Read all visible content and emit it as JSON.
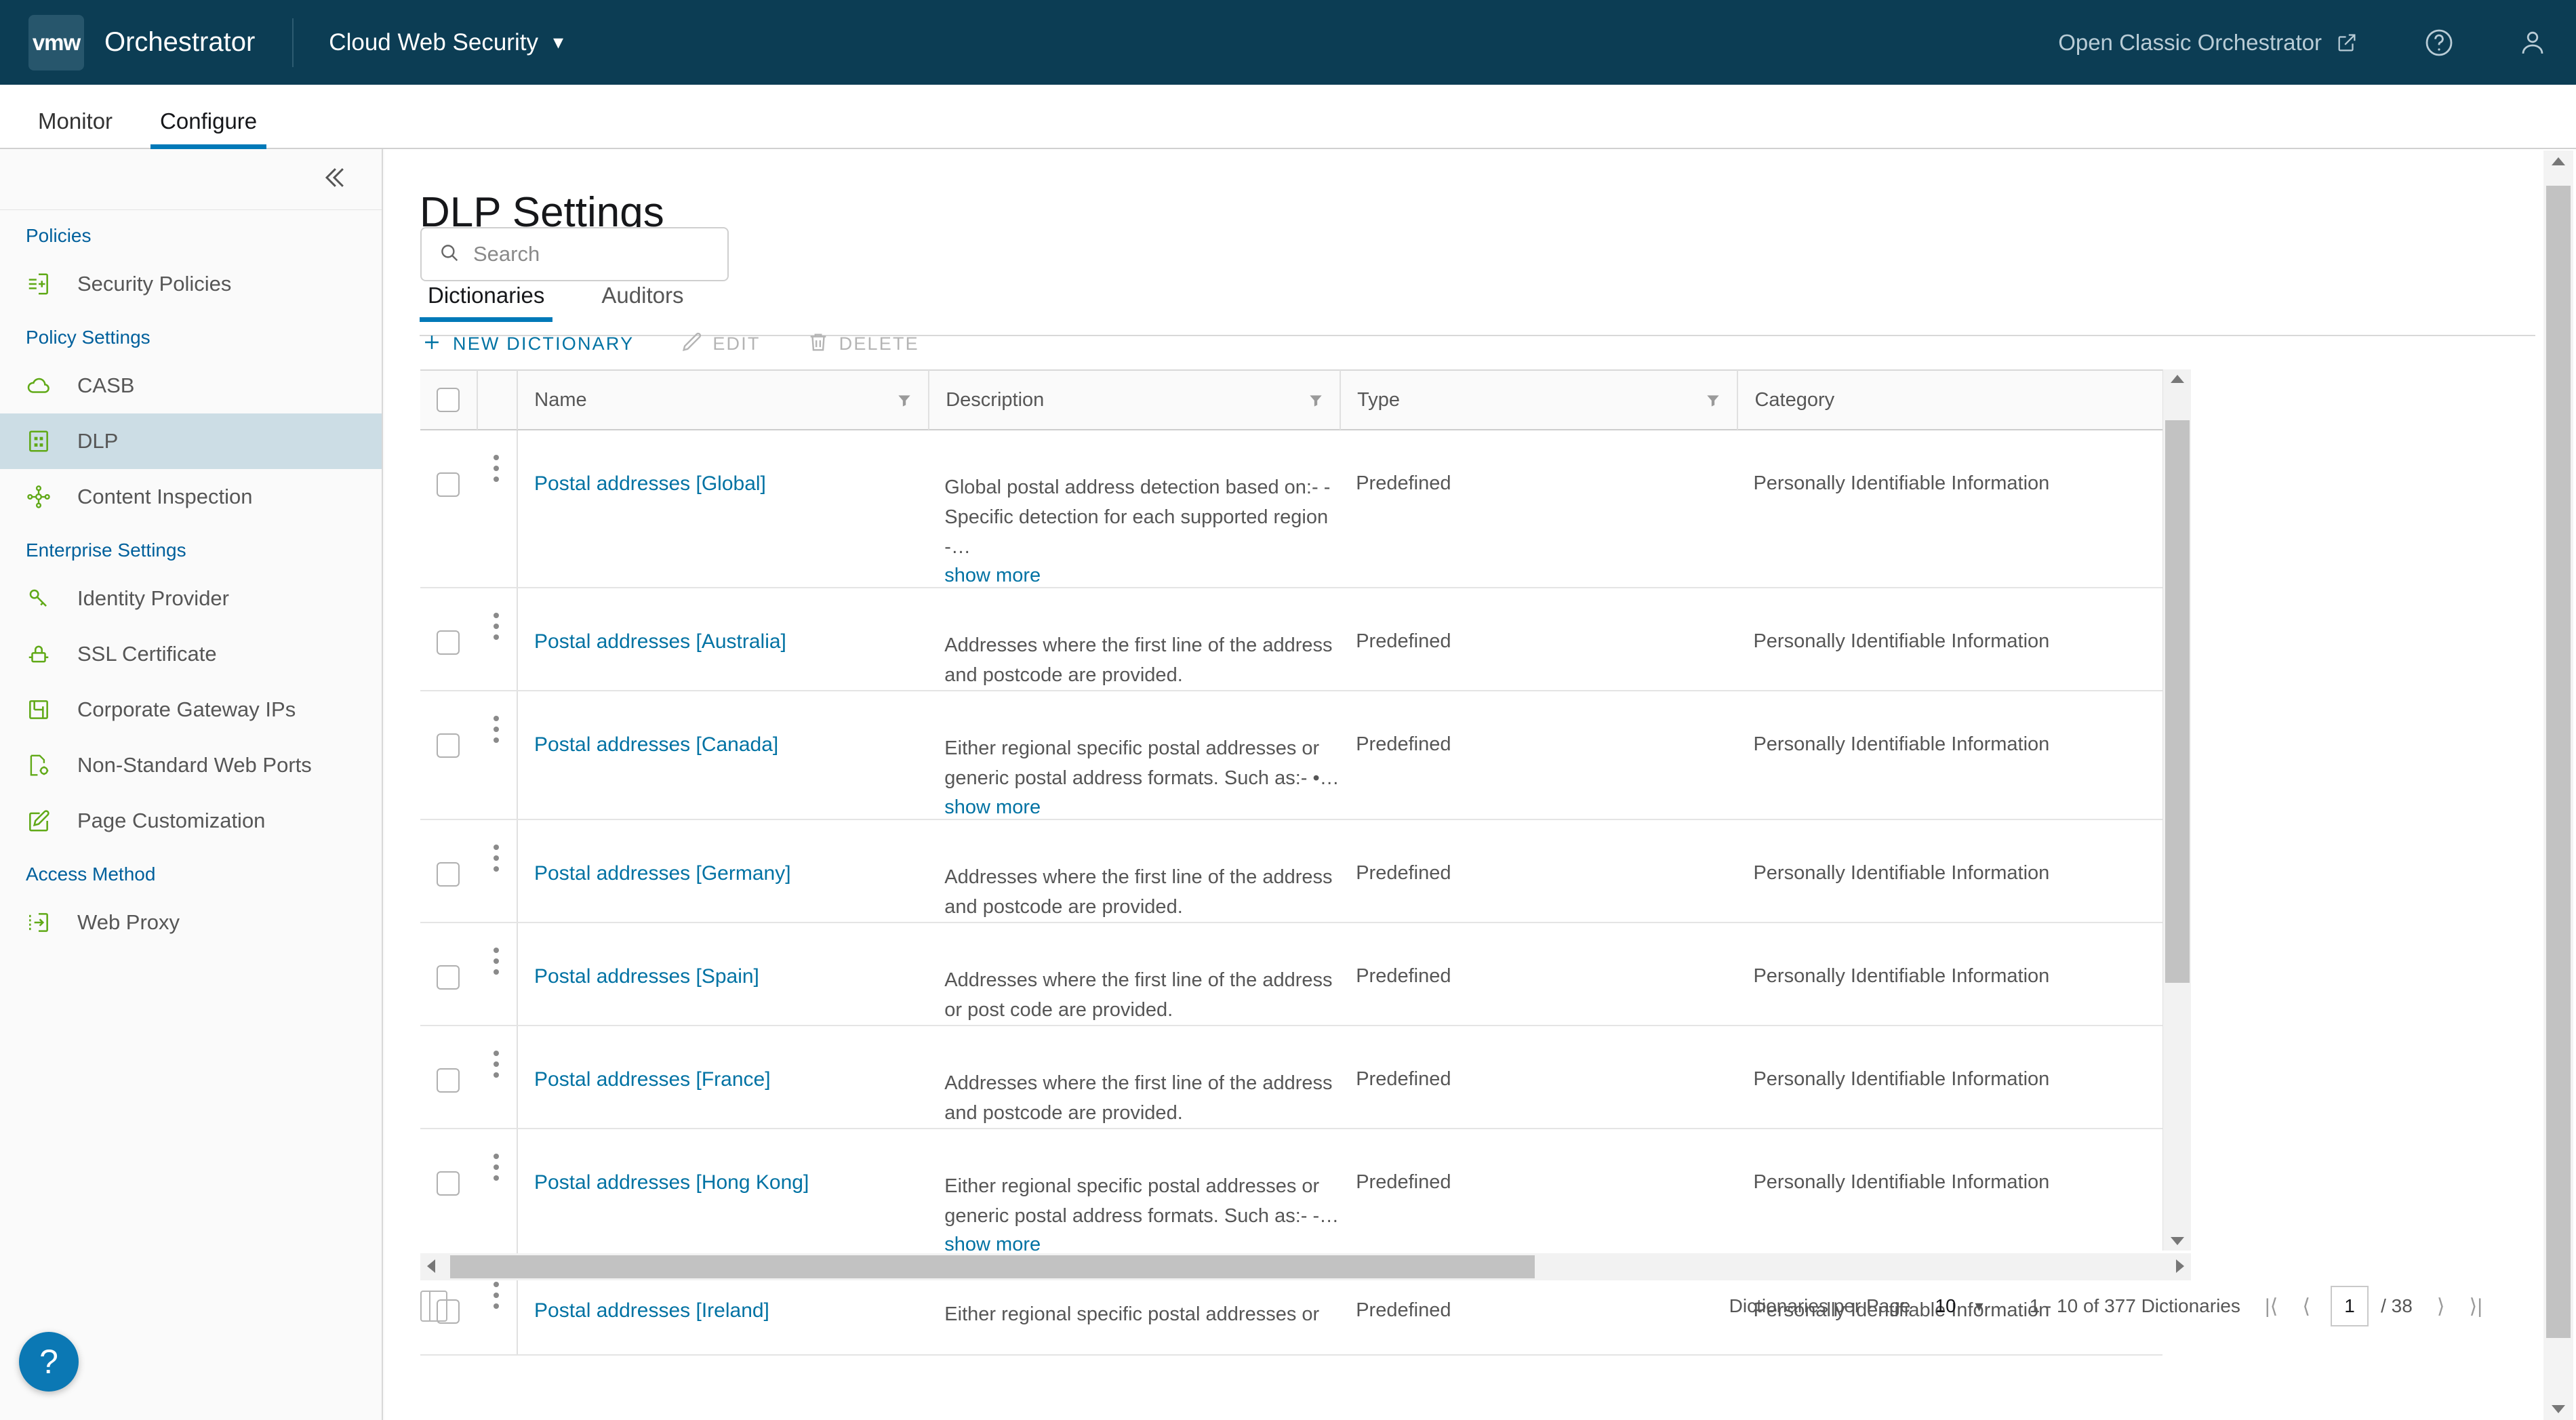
{
  "header": {
    "logo_text": "vmw",
    "app_title": "Orchestrator",
    "service_name": "Cloud Web Security",
    "service_caret": "chevron-down-icon",
    "classic_link": "Open Classic Orchestrator",
    "external_icon": "external-link-icon",
    "help_icon": "help-circle-icon",
    "user_icon": "user-avatar-icon",
    "bg_color": "#0c3d54"
  },
  "nav_tabs": [
    {
      "label": "Monitor",
      "active": false
    },
    {
      "label": "Configure",
      "active": true
    }
  ],
  "sidebar": {
    "collapse_icon": "double-chevron-left-icon",
    "groups": [
      {
        "title": "Policies",
        "items": [
          {
            "label": "Security Policies",
            "icon": "policy-add-icon",
            "selected": false
          }
        ]
      },
      {
        "title": "Policy Settings",
        "items": [
          {
            "label": "CASB",
            "icon": "cloud-icon",
            "selected": false
          },
          {
            "label": "DLP",
            "icon": "grid-table-icon",
            "selected": true
          },
          {
            "label": "Content Inspection",
            "icon": "nodes-icon",
            "selected": false
          }
        ]
      },
      {
        "title": "Enterprise Settings",
        "items": [
          {
            "label": "Identity Provider",
            "icon": "key-icon",
            "selected": false
          },
          {
            "label": "SSL Certificate",
            "icon": "lock-icon",
            "selected": false
          },
          {
            "label": "Corporate Gateway IPs",
            "icon": "network-icon",
            "selected": false
          },
          {
            "label": "Non-Standard Web Ports",
            "icon": "page-gear-icon",
            "selected": false
          }
        ]
      },
      {
        "title": "",
        "items": [
          {
            "label": "Page Customization",
            "icon": "pencil-page-icon",
            "selected": false
          }
        ]
      },
      {
        "title": "Access Method",
        "items": [
          {
            "label": "Web Proxy",
            "icon": "proxy-arrow-icon",
            "selected": false
          }
        ]
      }
    ],
    "help_fab": "?"
  },
  "main": {
    "page_title": "DLP Settings",
    "tabs": [
      {
        "label": "Dictionaries",
        "active": true
      },
      {
        "label": "Auditors",
        "active": false
      }
    ],
    "search": {
      "placeholder": "Search",
      "value": "",
      "icon": "search-icon"
    },
    "actions": [
      {
        "label": "NEW DICTIONARY",
        "icon": "plus-icon",
        "enabled": true
      },
      {
        "label": "EDIT",
        "icon": "pencil-icon",
        "enabled": false
      },
      {
        "label": "DELETE",
        "icon": "trash-icon",
        "enabled": false
      }
    ],
    "table": {
      "columns": [
        {
          "label": "Name",
          "filter": true
        },
        {
          "label": "Description",
          "filter": true
        },
        {
          "label": "Type",
          "filter": true
        },
        {
          "label": "Category",
          "filter": false
        }
      ],
      "select_all_checked": false,
      "rows": [
        {
          "name": "Postal addresses [Global]",
          "description": "Global postal address detection based on:- - Specific detection for each supported region -…",
          "show_more": "show more",
          "type": "Predefined",
          "category": "Personally Identifiable Information"
        },
        {
          "name": "Postal addresses [Australia]",
          "description": "Addresses where the first line of the address and postcode are provided.",
          "show_more": "",
          "type": "Predefined",
          "category": "Personally Identifiable Information"
        },
        {
          "name": "Postal addresses [Canada]",
          "description": "Either regional specific postal addresses or generic postal address formats. Such as:- •…",
          "show_more": "show more",
          "type": "Predefined",
          "category": "Personally Identifiable Information"
        },
        {
          "name": "Postal addresses [Germany]",
          "description": "Addresses where the first line of the address and postcode are provided.",
          "show_more": "",
          "type": "Predefined",
          "category": "Personally Identifiable Information"
        },
        {
          "name": "Postal addresses [Spain]",
          "description": "Addresses where the first line of the address or post code are provided.",
          "show_more": "",
          "type": "Predefined",
          "category": "Personally Identifiable Information"
        },
        {
          "name": "Postal addresses [France]",
          "description": "Addresses where the first line of the address and postcode are provided.",
          "show_more": "",
          "type": "Predefined",
          "category": "Personally Identifiable Information"
        },
        {
          "name": "Postal addresses [Hong Kong]",
          "description": "Either regional specific postal addresses or generic postal address formats. Such as:- -…",
          "show_more": "show more",
          "type": "Predefined",
          "category": "Personally Identifiable Information"
        },
        {
          "name": "Postal addresses [Ireland]",
          "description": "Either regional specific postal addresses or",
          "show_more": "",
          "type": "Predefined",
          "category": "Personally Identifiable Information"
        }
      ]
    }
  },
  "footer": {
    "column_toggle_icon": "column-layout-icon",
    "per_page_label": "Dictionaries per Page",
    "per_page_value": "10",
    "per_page_caret": "chevron-down-icon",
    "range_text": "1 - 10 of 377 Dictionaries",
    "first_btn": "|⟨",
    "prev_btn": "⟨",
    "current_page": "1",
    "total_pages": "/ 38",
    "next_btn": "⟩",
    "last_btn": "⟩|"
  },
  "colors": {
    "header_bg": "#0c3d54",
    "accent_blue": "#0079b8",
    "link_blue": "#0072a3",
    "group_blue": "#00609c",
    "icon_green": "#60a917",
    "selected_row": "#ccdde5"
  }
}
